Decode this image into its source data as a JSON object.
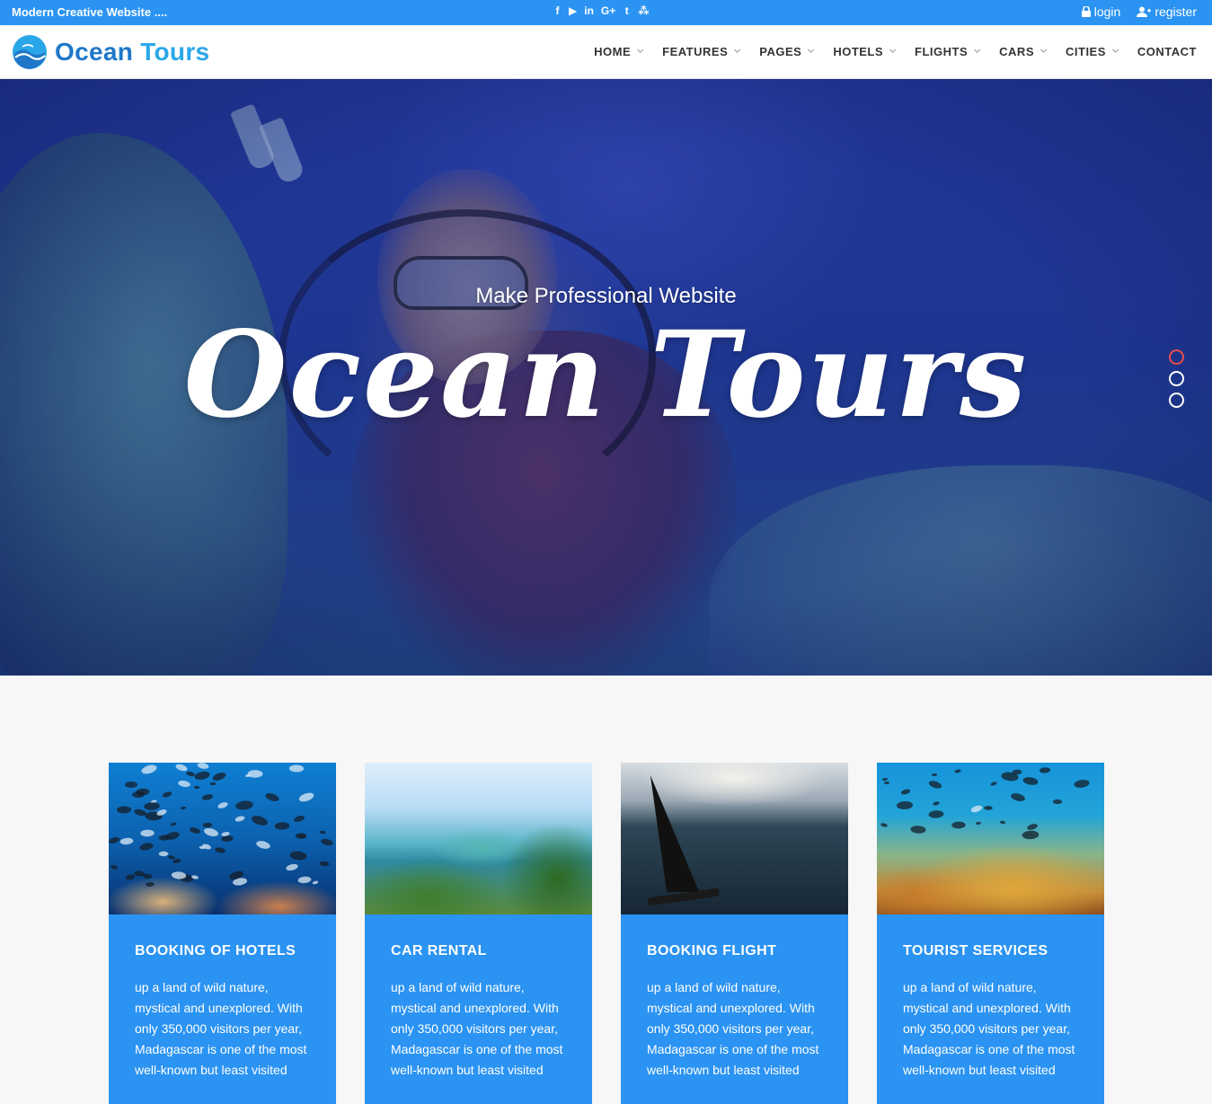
{
  "topbar": {
    "tagline": "Modern Creative Website ....",
    "socials": [
      {
        "icon": "facebook-icon",
        "glyph": "f"
      },
      {
        "icon": "youtube-icon",
        "glyph": "▶"
      },
      {
        "icon": "linkedin-icon",
        "glyph": "in"
      },
      {
        "icon": "google-plus-icon",
        "glyph": "G+"
      },
      {
        "icon": "twitter-icon",
        "glyph": "t"
      },
      {
        "icon": "rss-icon",
        "glyph": "⁂"
      }
    ],
    "login_label": "login",
    "register_label": "register"
  },
  "brand": {
    "name_part1": "Ocean",
    "name_part2": "Tours"
  },
  "nav": {
    "items": [
      {
        "label": "HOME",
        "has_dropdown": true
      },
      {
        "label": "FEATURES",
        "has_dropdown": true
      },
      {
        "label": "PAGES",
        "has_dropdown": true
      },
      {
        "label": "HOTELS",
        "has_dropdown": true
      },
      {
        "label": "FLIGHTS",
        "has_dropdown": true
      },
      {
        "label": "CARS",
        "has_dropdown": true
      },
      {
        "label": "CITIES",
        "has_dropdown": true
      },
      {
        "label": "CONTACT",
        "has_dropdown": false
      }
    ]
  },
  "hero": {
    "subtitle": "Make Professional Website",
    "title": "Ocean Tours",
    "slides": 3,
    "active_slide": 0
  },
  "services": [
    {
      "title": "BOOKING OF HOTELS",
      "lines": [
        "up a land of wild nature,",
        "mystical and unexplored. With",
        "only 350,000 visitors per year,",
        "Madagascar is one of the most",
        "well-known but least visited"
      ]
    },
    {
      "title": "CAR RENTAL",
      "lines": [
        "up a land of wild nature,",
        "mystical and unexplored. With",
        "only 350,000 visitors per year,",
        "Madagascar is one of the most",
        "well-known but least visited"
      ]
    },
    {
      "title": "BOOKING FLIGHT",
      "lines": [
        "up a land of wild nature,",
        "mystical and unexplored. With",
        "only 350,000 visitors per year,",
        "Madagascar is one of the most",
        "well-known but least visited"
      ]
    },
    {
      "title": "TOURIST SERVICES",
      "lines": [
        "up a land of wild nature,",
        "mystical and unexplored. With",
        "only 350,000 visitors per year,",
        "Madagascar is one of the most",
        "well-known but least visited"
      ]
    }
  ],
  "colors": {
    "primary": "#2b93f2",
    "brand_dark": "#1f77c9",
    "brand_light": "#2aa7e8",
    "active_dot": "#e74b4b"
  }
}
